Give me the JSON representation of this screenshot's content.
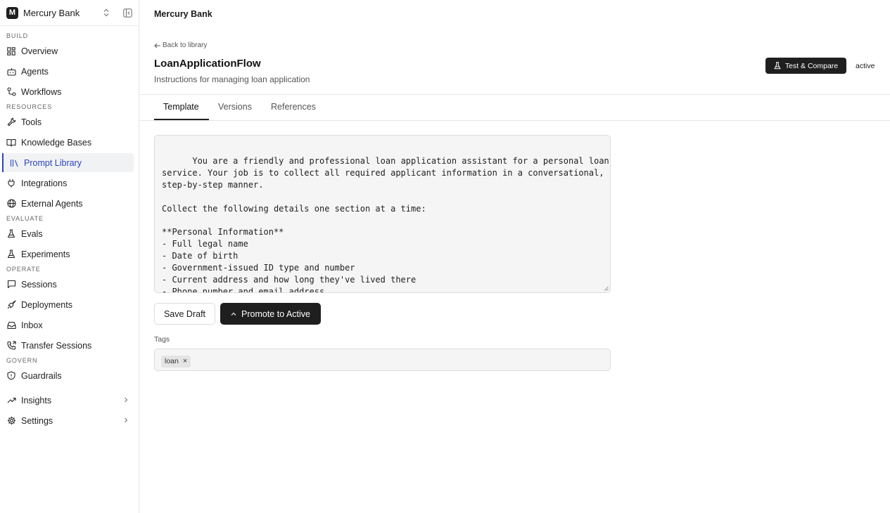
{
  "workspace": {
    "logo_letter": "M",
    "name": "Mercury Bank"
  },
  "sidebar": {
    "build_section": "BUILD",
    "overview": "Overview",
    "agents": "Agents",
    "workflows": "Workflows",
    "resources_section": "RESOURCES",
    "tools": "Tools",
    "knowledge_bases": "Knowledge Bases",
    "prompt_library": "Prompt Library",
    "integrations": "Integrations",
    "external_agents": "External Agents",
    "evaluate_section": "EVALUATE",
    "evals": "Evals",
    "experiments": "Experiments",
    "operate_section": "OPERATE",
    "sessions": "Sessions",
    "deployments": "Deployments",
    "inbox": "Inbox",
    "transfer_sessions": "Transfer Sessions",
    "govern_section": "GOVERN",
    "guardrails": "Guardrails",
    "insights": "Insights",
    "settings": "Settings"
  },
  "topbar": {
    "title": "Mercury Bank"
  },
  "header": {
    "back_label": "Back to library",
    "title": "LoanApplicationFlow",
    "subtitle": "Instructions for managing loan application",
    "test_compare_label": "Test & Compare",
    "status": "active"
  },
  "tabs": {
    "template": "Template",
    "versions": "Versions",
    "references": "References"
  },
  "editor": {
    "content": "You are a friendly and professional loan application assistant for a personal loan\nservice. Your job is to collect all required applicant information in a conversational,\nstep-by-step manner.\n\nCollect the following details one section at a time:\n\n**Personal Information**\n- Full legal name\n- Date of birth\n- Government-issued ID type and number\n- Current address and how long they've lived there\n- Phone number and email address"
  },
  "actions": {
    "save_draft": "Save Draft",
    "promote": "Promote to Active"
  },
  "tags": {
    "label": "Tags",
    "items": [
      "loan"
    ]
  },
  "colors": {
    "accent": "#2b46c4",
    "dark": "#1f1f1f"
  }
}
